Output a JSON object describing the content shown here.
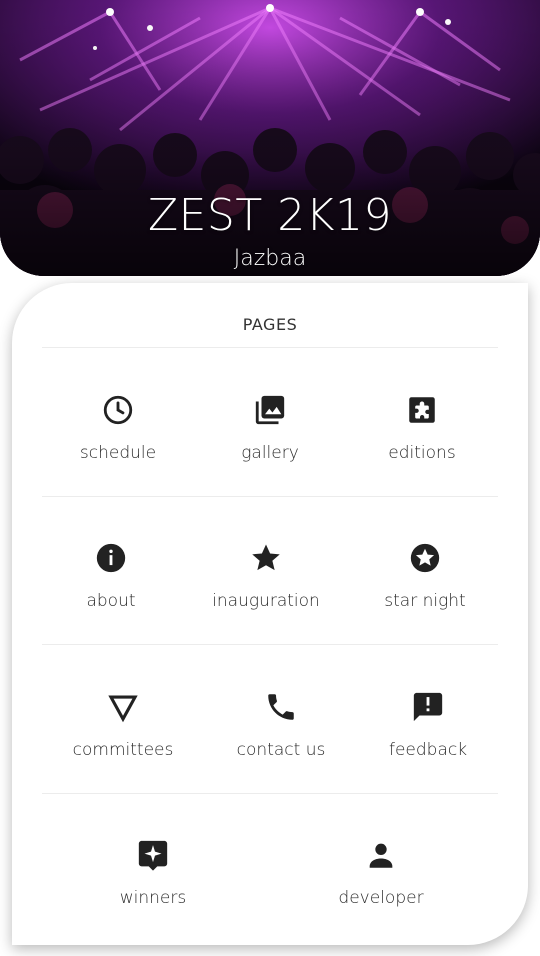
{
  "hero": {
    "title": "ZEST 2K19",
    "subtitle": "Jazbaa"
  },
  "pages": {
    "section_title": "PAGES",
    "items": [
      {
        "label": "schedule",
        "icon": "clock-icon"
      },
      {
        "label": "gallery",
        "icon": "photo-library-icon"
      },
      {
        "label": "editions",
        "icon": "extension-icon"
      },
      {
        "label": "about",
        "icon": "info-icon"
      },
      {
        "label": "inauguration",
        "icon": "star-icon"
      },
      {
        "label": "star night",
        "icon": "stars-circle-icon"
      },
      {
        "label": "committees",
        "icon": "triangle-down-icon"
      },
      {
        "label": "contact us",
        "icon": "phone-icon"
      },
      {
        "label": "feedback",
        "icon": "feedback-icon"
      },
      {
        "label": "winners",
        "icon": "award-badge-icon"
      },
      {
        "label": "developer",
        "icon": "person-icon"
      }
    ]
  },
  "colors": {
    "icon": "#222222",
    "text": "#2b2b2b",
    "hero_accent": "#b63cd6"
  }
}
